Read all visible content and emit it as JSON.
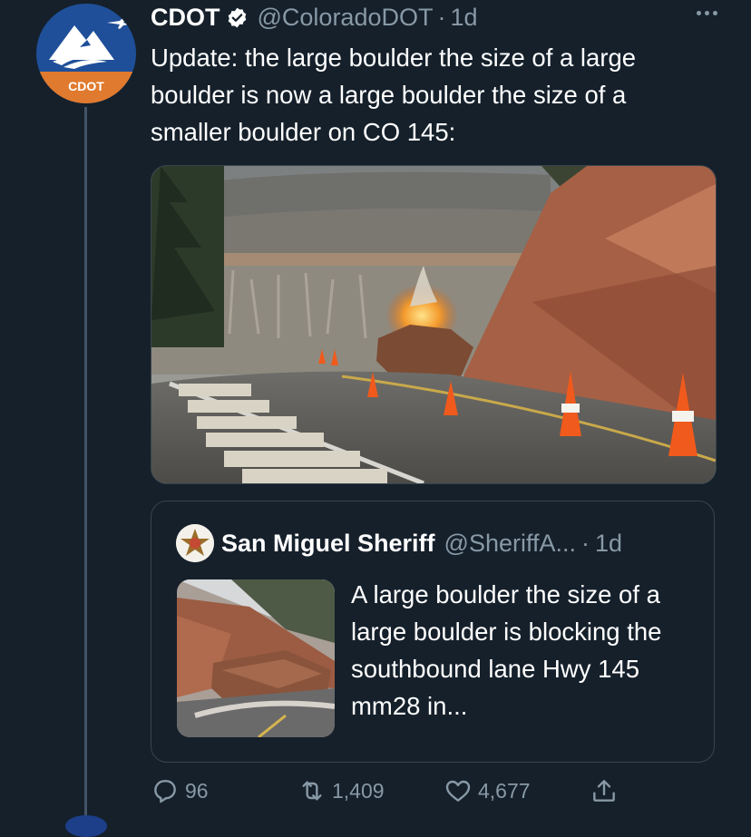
{
  "tweet": {
    "author_name": "CDOT",
    "author_handle": "@ColoradoDOT",
    "separator": "·",
    "time": "1d",
    "avatar_text": "CDOT",
    "text": "Update: the large boulder the size of a large boulder is now a large boulder the size of a smaller boulder on CO 145:",
    "media_icon": "photo-road-blast"
  },
  "quoted_tweet": {
    "author_name": "San Miguel Sheriff",
    "author_handle": "@SheriffA...",
    "separator": "·",
    "time": "1d",
    "text": "A large boulder the size of a large boulder is blocking the southbound lane Hwy 145 mm28 in..."
  },
  "actions": {
    "replies": "96",
    "retweets": "1,409",
    "likes": "4,677"
  },
  "colors": {
    "background": "#15202b",
    "secondary_text": "#8899a6",
    "border": "#38444d",
    "cdot_blue": "#1f4f99",
    "cdot_orange": "#e07a2e"
  }
}
